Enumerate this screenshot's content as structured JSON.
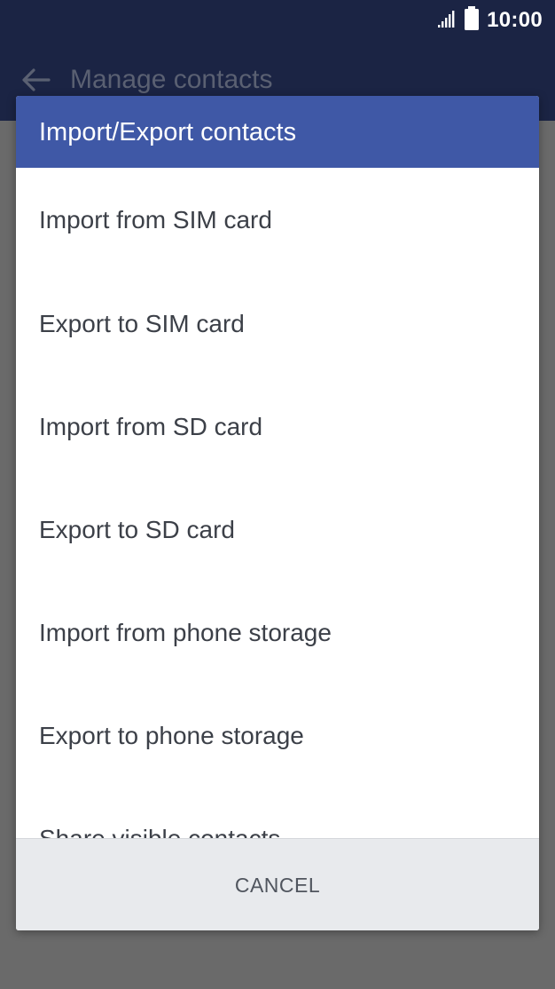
{
  "status_bar": {
    "time": "10:00",
    "icons": [
      "signal-icon",
      "battery-icon"
    ]
  },
  "app_bar": {
    "back_icon": "arrow-left-icon",
    "title": "Manage contacts"
  },
  "dialog": {
    "title": "Import/Export contacts",
    "items": [
      {
        "label": "Import from SIM card"
      },
      {
        "label": "Export to SIM card"
      },
      {
        "label": "Import from SD card"
      },
      {
        "label": "Export to SD card"
      },
      {
        "label": "Import from phone storage"
      },
      {
        "label": "Export to phone storage"
      },
      {
        "label": "Share visible contacts"
      }
    ],
    "cancel_label": "CANCEL"
  },
  "colors": {
    "status_bar": "#1b2444",
    "dialog_header": "#3f58a6",
    "scrim": "#6a6a6a",
    "dialog_footer": "#e8eaed"
  }
}
